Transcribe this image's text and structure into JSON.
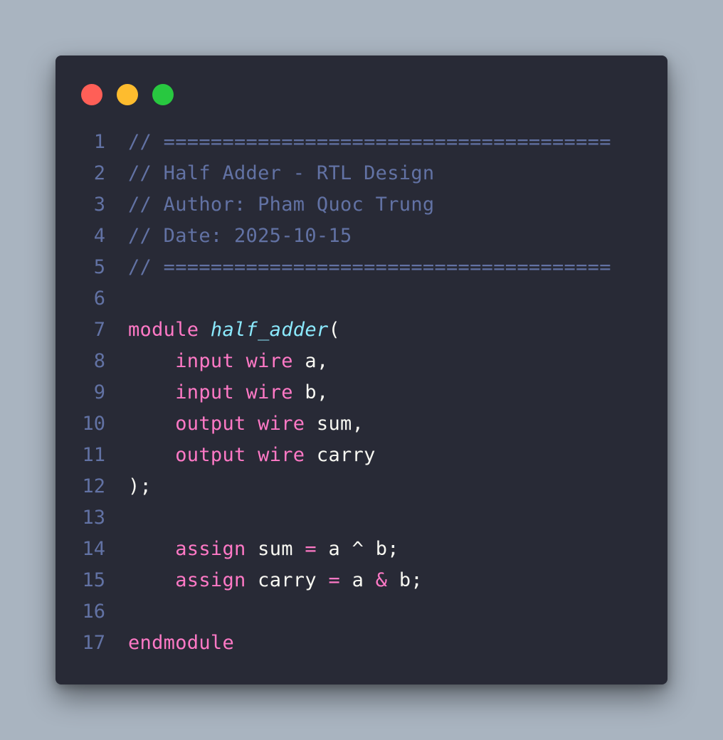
{
  "window_controls": [
    {
      "name": "close",
      "color": "#ff5f57"
    },
    {
      "name": "minimize",
      "color": "#febc2e"
    },
    {
      "name": "maximize",
      "color": "#28c840"
    }
  ],
  "theme": {
    "background": "#282a36",
    "comment": "#6272a4",
    "keyword": "#ff79c6",
    "function": "#8be9fd",
    "text": "#f8f8f2"
  },
  "code": {
    "language": "Verilog",
    "lines": [
      {
        "num": "1",
        "tokens": [
          {
            "t": "comment",
            "v": "// ======================================"
          }
        ]
      },
      {
        "num": "2",
        "tokens": [
          {
            "t": "comment",
            "v": "// Half Adder - RTL Design"
          }
        ]
      },
      {
        "num": "3",
        "tokens": [
          {
            "t": "comment",
            "v": "// Author: Pham Quoc Trung"
          }
        ]
      },
      {
        "num": "4",
        "tokens": [
          {
            "t": "comment",
            "v": "// Date: 2025-10-15"
          }
        ]
      },
      {
        "num": "5",
        "tokens": [
          {
            "t": "comment",
            "v": "// ======================================"
          }
        ]
      },
      {
        "num": "6",
        "tokens": []
      },
      {
        "num": "7",
        "tokens": [
          {
            "t": "keyword",
            "v": "module"
          },
          {
            "t": "ident",
            "v": " "
          },
          {
            "t": "function",
            "v": "half_adder"
          },
          {
            "t": "punct",
            "v": "("
          }
        ]
      },
      {
        "num": "8",
        "tokens": [
          {
            "t": "ident",
            "v": "    "
          },
          {
            "t": "keyword",
            "v": "input"
          },
          {
            "t": "ident",
            "v": " "
          },
          {
            "t": "keyword",
            "v": "wire"
          },
          {
            "t": "ident",
            "v": " a"
          },
          {
            "t": "punct",
            "v": ","
          }
        ]
      },
      {
        "num": "9",
        "tokens": [
          {
            "t": "ident",
            "v": "    "
          },
          {
            "t": "keyword",
            "v": "input"
          },
          {
            "t": "ident",
            "v": " "
          },
          {
            "t": "keyword",
            "v": "wire"
          },
          {
            "t": "ident",
            "v": " b"
          },
          {
            "t": "punct",
            "v": ","
          }
        ]
      },
      {
        "num": "10",
        "tokens": [
          {
            "t": "ident",
            "v": "    "
          },
          {
            "t": "keyword",
            "v": "output"
          },
          {
            "t": "ident",
            "v": " "
          },
          {
            "t": "keyword",
            "v": "wire"
          },
          {
            "t": "ident",
            "v": " sum"
          },
          {
            "t": "punct",
            "v": ","
          }
        ]
      },
      {
        "num": "11",
        "tokens": [
          {
            "t": "ident",
            "v": "    "
          },
          {
            "t": "keyword",
            "v": "output"
          },
          {
            "t": "ident",
            "v": " "
          },
          {
            "t": "keyword",
            "v": "wire"
          },
          {
            "t": "ident",
            "v": " carry"
          }
        ]
      },
      {
        "num": "12",
        "tokens": [
          {
            "t": "punct",
            "v": ");"
          }
        ]
      },
      {
        "num": "13",
        "tokens": []
      },
      {
        "num": "14",
        "tokens": [
          {
            "t": "ident",
            "v": "    "
          },
          {
            "t": "keyword",
            "v": "assign"
          },
          {
            "t": "ident",
            "v": " sum "
          },
          {
            "t": "operator",
            "v": "="
          },
          {
            "t": "ident",
            "v": " a ^ b"
          },
          {
            "t": "punct",
            "v": ";"
          }
        ]
      },
      {
        "num": "15",
        "tokens": [
          {
            "t": "ident",
            "v": "    "
          },
          {
            "t": "keyword",
            "v": "assign"
          },
          {
            "t": "ident",
            "v": " carry "
          },
          {
            "t": "operator",
            "v": "="
          },
          {
            "t": "ident",
            "v": " a "
          },
          {
            "t": "operator",
            "v": "&"
          },
          {
            "t": "ident",
            "v": " b"
          },
          {
            "t": "punct",
            "v": ";"
          }
        ]
      },
      {
        "num": "16",
        "tokens": []
      },
      {
        "num": "17",
        "tokens": [
          {
            "t": "keyword",
            "v": "endmodule"
          }
        ]
      }
    ]
  }
}
